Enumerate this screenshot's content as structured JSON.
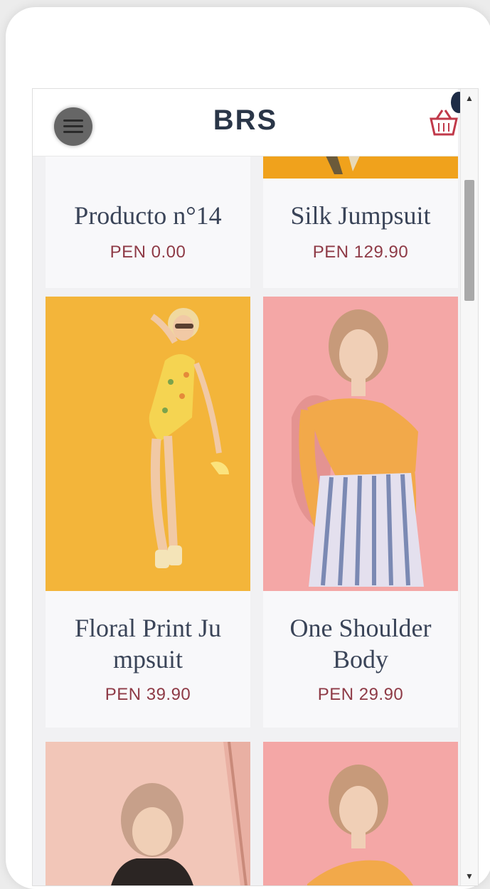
{
  "header": {
    "brand": "BRS"
  },
  "products": [
    {
      "name": "Producto n°14",
      "price": "PEN 0.00"
    },
    {
      "name": "Silk Jumpsuit",
      "price": "PEN 129.90"
    },
    {
      "name": "Floral Print Ju mpsuit",
      "name_line1": "Floral Print Ju",
      "name_line2": "mpsuit",
      "price": "PEN 39.90",
      "photo_bg": "#f3b53a"
    },
    {
      "name": "One Shoulder Body",
      "name_line1": "One Shoulder",
      "name_line2": "Body",
      "price": "PEN 29.90",
      "photo_bg": "#f4a7a6"
    },
    {
      "photo_bg": "#f2c6b8"
    },
    {
      "photo_bg": "#f4a7a6"
    }
  ],
  "colors": {
    "accent": "#8e3a46",
    "brand": "#2a3648",
    "badge": "#1e2c46"
  }
}
